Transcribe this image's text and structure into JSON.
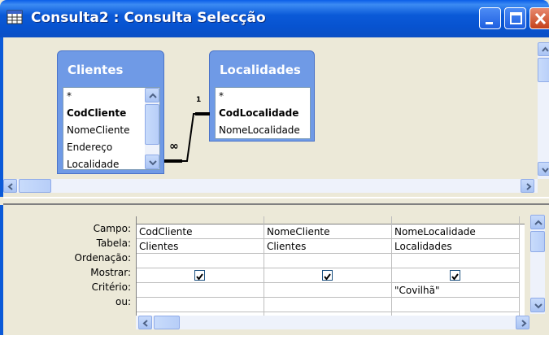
{
  "window": {
    "title": "Consulta2 : Consulta Selecção",
    "controls": [
      "minimize",
      "maximize",
      "close"
    ]
  },
  "tables": [
    {
      "name": "Clientes",
      "fields": [
        "*",
        "CodCliente",
        "NomeCliente",
        "Endereço",
        "Localidade"
      ],
      "bold_fields": [
        "CodCliente"
      ]
    },
    {
      "name": "Localidades",
      "fields": [
        "*",
        "CodLocalidade",
        "NomeLocalidade"
      ],
      "bold_fields": [
        "CodLocalidade"
      ]
    }
  ],
  "relationship": {
    "one_side": "1",
    "many_side": "∞"
  },
  "grid": {
    "row_labels": [
      "Campo:",
      "Tabela:",
      "Ordenação:",
      "Mostrar:",
      "Critério:",
      "ou:"
    ],
    "columns": [
      {
        "campo": "CodCliente",
        "tabela": "Clientes",
        "ordenacao": "",
        "mostrar": true,
        "criterio": "",
        "ou": ""
      },
      {
        "campo": "NomeCliente",
        "tabela": "Clientes",
        "ordenacao": "",
        "mostrar": true,
        "criterio": "",
        "ou": ""
      },
      {
        "campo": "NomeLocalidade",
        "tabela": "Localidades",
        "ordenacao": "",
        "mostrar": true,
        "criterio": "\"Covilhã\"",
        "ou": ""
      }
    ]
  }
}
